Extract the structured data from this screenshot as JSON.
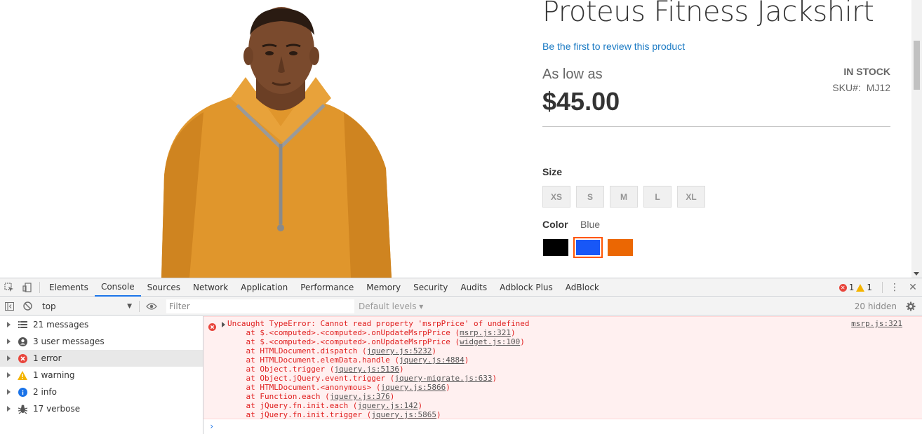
{
  "product": {
    "title": "Proteus Fitness Jackshirt",
    "review_link": "Be the first to review this product",
    "as_low_as": "As low as",
    "price": "$45.00",
    "stock": "IN STOCK",
    "sku_label": "SKU#:",
    "sku_value": "MJ12",
    "size_label": "Size",
    "sizes": [
      "XS",
      "S",
      "M",
      "L",
      "XL"
    ],
    "color_label": "Color",
    "color_selected": "Blue",
    "colors": [
      "#000000",
      "#1857f7",
      "#eb6703"
    ],
    "image_icon": "jacket-model-photo"
  },
  "devtools": {
    "tabs": [
      "Elements",
      "Console",
      "Sources",
      "Network",
      "Application",
      "Performance",
      "Memory",
      "Security",
      "Audits",
      "Adblock Plus",
      "AdBlock"
    ],
    "active_tab": "Console",
    "error_count": "1",
    "warning_count": "1",
    "context": "top",
    "filter_placeholder": "Filter",
    "levels": "Default levels ▾",
    "hidden": "20 hidden",
    "sidebar": [
      {
        "label": "21 messages",
        "icon": "list-icon"
      },
      {
        "label": "3 user messages",
        "icon": "user-icon"
      },
      {
        "label": "1 error",
        "icon": "error-icon"
      },
      {
        "label": "1 warning",
        "icon": "warning-icon"
      },
      {
        "label": "2 info",
        "icon": "info-icon"
      },
      {
        "label": "17 verbose",
        "icon": "bug-icon"
      }
    ],
    "error": {
      "message": "Uncaught TypeError: Cannot read property 'msrpPrice' of undefined",
      "source": "msrp.js:321",
      "stack": [
        {
          "prefix": "    at $.<computed>.<computed>.onUpdateMsrpPrice (",
          "link": "msrp.js:321",
          "suffix": ")"
        },
        {
          "prefix": "    at $.<computed>.<computed>.onUpdateMsrpPrice (",
          "link": "widget.js:100",
          "suffix": ")"
        },
        {
          "prefix": "    at HTMLDocument.dispatch (",
          "link": "jquery.js:5232",
          "suffix": ")"
        },
        {
          "prefix": "    at HTMLDocument.elemData.handle (",
          "link": "jquery.js:4884",
          "suffix": ")"
        },
        {
          "prefix": "    at Object.trigger (",
          "link": "jquery.js:5136",
          "suffix": ")"
        },
        {
          "prefix": "    at Object.jQuery.event.trigger (",
          "link": "jquery-migrate.js:633",
          "suffix": ")"
        },
        {
          "prefix": "    at HTMLDocument.<anonymous> (",
          "link": "jquery.js:5866",
          "suffix": ")"
        },
        {
          "prefix": "    at Function.each (",
          "link": "jquery.js:376",
          "suffix": ")"
        },
        {
          "prefix": "    at jQuery.fn.init.each (",
          "link": "jquery.js:142",
          "suffix": ")"
        },
        {
          "prefix": "    at jQuery.fn.init.trigger (",
          "link": "jquery.js:5865",
          "suffix": ")"
        }
      ]
    },
    "prompt": "›"
  }
}
